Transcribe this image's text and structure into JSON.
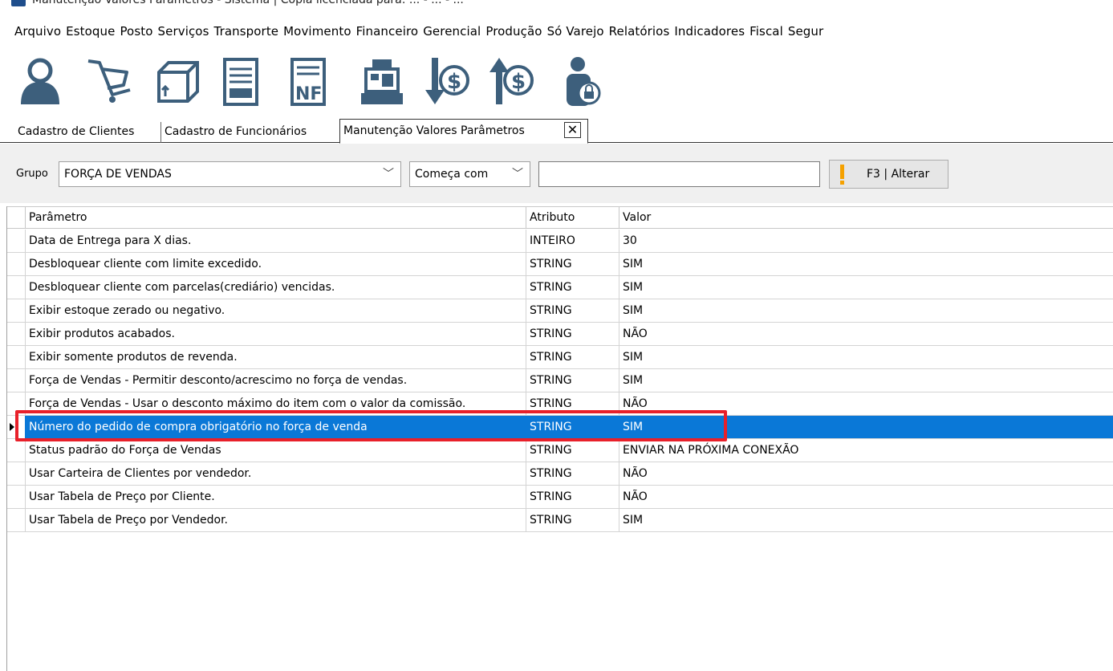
{
  "window": {
    "title": "Manutenção Valores Parâmetros - Sistema | Cópia licenciada para: ... - ... - ..."
  },
  "menu": [
    "Arquivo",
    "Estoque",
    "Posto",
    "Serviços",
    "Transporte",
    "Movimento",
    "Financeiro",
    "Gerencial",
    "Produção",
    "Só Varejo",
    "Relatórios",
    "Indicadores",
    "Fiscal",
    "Segur"
  ],
  "toolbar": {
    "icons": [
      "user-icon",
      "cart-icon",
      "box-icon",
      "document-icon",
      "nf-invoice-icon",
      "cash-register-icon",
      "money-down-icon",
      "money-up-icon",
      "user-lock-icon"
    ],
    "nf_label": "NF",
    "dollar": "$"
  },
  "tabs": [
    {
      "label": "Cadastro de Clientes"
    },
    {
      "label": "Cadastro de Funcionários"
    },
    {
      "label": "Manutenção Valores Parâmetros"
    }
  ],
  "tab_close": "✕",
  "filters": {
    "grupo_label": "Grupo",
    "grupo_value": "FORÇA DE VENDAS",
    "match_value": "Começa com",
    "search_value": "",
    "alter_button": "F3 | Alterar"
  },
  "grid": {
    "headers": [
      "Parâmetro",
      "Atributo",
      "Valor"
    ],
    "rows": [
      {
        "param": "Data de Entrega para X dias.",
        "attr": "INTEIRO",
        "value": "30"
      },
      {
        "param": "Desbloquear cliente com limite excedido.",
        "attr": "STRING",
        "value": "SIM"
      },
      {
        "param": "Desbloquear cliente com parcelas(crediário) vencidas.",
        "attr": "STRING",
        "value": "SIM"
      },
      {
        "param": "Exibir estoque zerado ou negativo.",
        "attr": "STRING",
        "value": "SIM"
      },
      {
        "param": "Exibir produtos acabados.",
        "attr": "STRING",
        "value": "NÃO"
      },
      {
        "param": "Exibir somente produtos de revenda.",
        "attr": "STRING",
        "value": "SIM"
      },
      {
        "param": "Força de Vendas - Permitir desconto/acrescimo no força de vendas.",
        "attr": "STRING",
        "value": "SIM"
      },
      {
        "param": "Força de Vendas - Usar o desconto máximo do item com o valor da comissão.",
        "attr": "STRING",
        "value": "NÃO"
      },
      {
        "param": "Número do pedido de compra obrigatório no força de venda",
        "attr": "STRING",
        "value": "SIM"
      },
      {
        "param": "Status padrão do Força de Vendas",
        "attr": "STRING",
        "value": "ENVIAR NA PRÓXIMA CONEXÃO"
      },
      {
        "param": "Usar Carteira de Clientes por vendedor.",
        "attr": "STRING",
        "value": "NÃO"
      },
      {
        "param": "Usar Tabela de Preço por Cliente.",
        "attr": "STRING",
        "value": "NÃO"
      },
      {
        "param": "Usar Tabela de Preço por Vendedor.",
        "attr": "STRING",
        "value": "SIM"
      }
    ],
    "selected_index": 8
  },
  "colors": {
    "selection": "#0a78d7",
    "highlight": "#e8202a",
    "icon": "#3d5f7c"
  }
}
